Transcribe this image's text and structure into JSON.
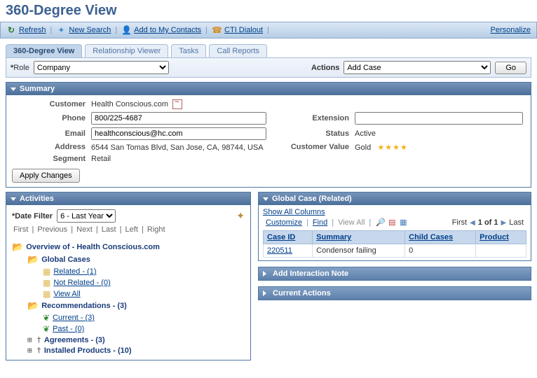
{
  "title": "360-Degree View",
  "toolbar": {
    "refresh": "Refresh",
    "new_search": "New Search",
    "add_contacts": "Add to My Contacts",
    "cti": "CTI Dialout",
    "personalize": "Personalize"
  },
  "tabs": {
    "t360": "360-Degree View",
    "relationship": "Relationship Viewer",
    "tasks": "Tasks",
    "call_reports": "Call Reports"
  },
  "rolebar": {
    "role_label": "Role",
    "role_value": "Company",
    "actions_label": "Actions",
    "actions_value": "Add Case",
    "go": "Go"
  },
  "summary": {
    "header": "Summary",
    "labels": {
      "customer": "Customer",
      "phone": "Phone",
      "email": "Email",
      "address": "Address",
      "segment": "Segment",
      "extension": "Extension",
      "status": "Status",
      "cust_value": "Customer Value"
    },
    "customer": "Health Conscious.com",
    "phone": "800/225-4687",
    "email": "healthconscious@hc.com",
    "address": "6544 San Tomas Blvd, San Jose, CA, 98744, USA",
    "segment": "Retail",
    "extension": "",
    "status": "Active",
    "cust_value": "Gold",
    "stars": "★★★★",
    "apply": "Apply Changes"
  },
  "activities": {
    "header": "Activities",
    "date_filter_label": "Date Filter",
    "date_filter_value": "6 - Last Year",
    "pager": {
      "first": "First",
      "prev": "Previous",
      "next": "Next",
      "last": "Last",
      "left": "Left",
      "right": "Right"
    },
    "overview_prefix": "Overview of - ",
    "overview_name": "Health Conscious.com",
    "nodes": {
      "global_cases": "Global Cases",
      "related": "Related - (1)",
      "not_related": "Not Related - (0)",
      "view_all": "View All",
      "recommendations": "Recommendations - (3)",
      "current": "Current - (3)",
      "past": "Past - (0)",
      "agreements": "Agreements - (3)",
      "installed": "Installed Products - (10)"
    }
  },
  "global_case": {
    "header": "Global Case (Related)",
    "show_all": "Show All Columns",
    "toolbar": {
      "customize": "Customize",
      "find": "Find",
      "view_all": "View All",
      "first": "First",
      "range": "1 of 1",
      "last": "Last"
    },
    "cols": {
      "case_id": "Case ID",
      "summary": "Summary",
      "child": "Child Cases",
      "product": "Product"
    },
    "rows": [
      {
        "case_id": "220511",
        "summary": "Condensor failing",
        "child": "0",
        "product": ""
      }
    ]
  },
  "add_interaction": {
    "header": "Add Interaction Note"
  },
  "current_actions": {
    "header": "Current Actions"
  }
}
